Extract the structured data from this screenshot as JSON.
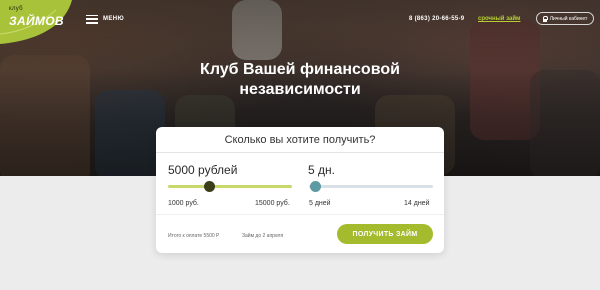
{
  "header": {
    "logo_small": "клуб",
    "logo_big": "ЗАЙМОВ",
    "menu_label": "МЕНЮ",
    "phone": "8 (863) 20-66-55-9",
    "urgent_link": "срочный займ",
    "cabinet_label": "Личный кабинет"
  },
  "hero": {
    "title": "Клуб Вашей финансовой независимости"
  },
  "calculator": {
    "title": "Сколько вы хотите получить?",
    "amount": {
      "value": "5000 рублей",
      "min_label": "1000 руб.",
      "max_label": "15000 руб.",
      "min": 1000,
      "max": 15000,
      "current": 5000
    },
    "days": {
      "value": "5 дн.",
      "min_label": "5 дней",
      "max_label": "14 дней",
      "min": 5,
      "max": 14,
      "current": 5
    },
    "total_label": "Итого к оплате 5500 Р",
    "due_label": "Займ до 2 апреля",
    "submit_label": "ПОЛУЧИТЬ ЗАЙМ"
  },
  "colors": {
    "accent": "#a3bb2c",
    "link": "#b5cf32",
    "amount_thumb": "#3c3e18",
    "days_thumb": "#5d9aa3"
  }
}
